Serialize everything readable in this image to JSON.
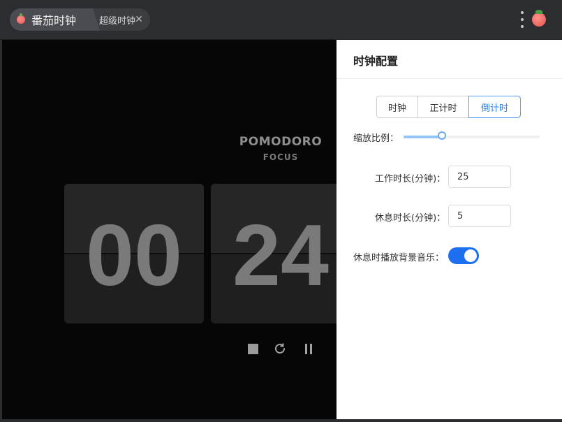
{
  "titlebar": {
    "app_tab_label": "番茄时钟",
    "sub_tab_label": "超级时钟",
    "close_glyph": "✕"
  },
  "clock": {
    "title": "POMODORO",
    "subtitle": "FOCUS",
    "digits_1": "00",
    "digits_2": "24"
  },
  "panel": {
    "title": "时钟配置",
    "modes": [
      "时钟",
      "正计时",
      "倒计时"
    ],
    "active_mode": "倒计时",
    "scale_label": "缩放比例：",
    "scale_value": 0.28,
    "work_label": "工作时长(分钟)：",
    "work_value": "25",
    "rest_label": "休息时长(分钟)：",
    "rest_value": "5",
    "music_label": "休息时播放背景音乐：",
    "music_enabled": true
  },
  "colors": {
    "accent": "#1e6ff0",
    "active_tab_text": "#2e7ee6"
  }
}
